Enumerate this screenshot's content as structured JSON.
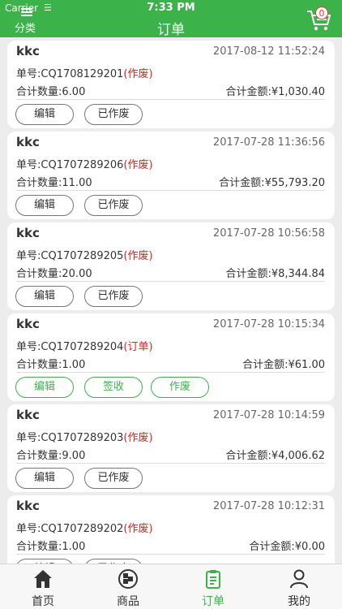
{
  "status_bar": {
    "carrier": "Carrier",
    "time": "7:33 PM"
  },
  "nav": {
    "category_label": "分类",
    "title": "订单",
    "cart_badge": "0"
  },
  "orders": [
    {
      "customer": "kkc",
      "date": "2017-08-12 11:52:24",
      "order_prefix": "单号:",
      "order_no": "CQ1708129201",
      "status": "(作废)",
      "qty_label": "合计数量:",
      "qty": "6.00",
      "amount_label": "合计金额:",
      "amount": "¥1,030.40",
      "buttons": [
        "编辑",
        "已作废"
      ]
    },
    {
      "customer": "kkc",
      "date": "2017-07-28 11:36:56",
      "order_prefix": "单号:",
      "order_no": "CQ1707289206",
      "status": "(作废)",
      "qty_label": "合计数量:",
      "qty": "11.00",
      "amount_label": "合计金额:",
      "amount": "¥55,793.20",
      "buttons": [
        "编辑",
        "已作废"
      ]
    },
    {
      "customer": "kkc",
      "date": "2017-07-28 10:56:58",
      "order_prefix": "单号:",
      "order_no": "CQ1707289205",
      "status": "(作废)",
      "qty_label": "合计数量:",
      "qty": "20.00",
      "amount_label": "合计金额:",
      "amount": "¥8,344.84",
      "buttons": [
        "编辑",
        "已作废"
      ]
    },
    {
      "customer": "kkc",
      "date": "2017-07-28 10:15:34",
      "order_prefix": "单号:",
      "order_no": "CQ1707289204",
      "status": "(订单)",
      "qty_label": "合计数量:",
      "qty": "1.00",
      "amount_label": "合计金额:",
      "amount": "¥61.00",
      "buttons": [
        "编辑",
        "签收",
        "作废"
      ]
    },
    {
      "customer": "kkc",
      "date": "2017-07-28 10:14:59",
      "order_prefix": "单号:",
      "order_no": "CQ1707289203",
      "status": "(作废)",
      "qty_label": "合计数量:",
      "qty": "9.00",
      "amount_label": "合计金额:",
      "amount": "¥4,006.62",
      "buttons": [
        "编辑",
        "已作废"
      ]
    },
    {
      "customer": "kkc",
      "date": "2017-07-28 10:12:31",
      "order_prefix": "单号:",
      "order_no": "CQ1707289202",
      "status": "(作废)",
      "qty_label": "合计数量:",
      "qty": "1.00",
      "amount_label": "合计金额:",
      "amount": "¥0.00",
      "buttons": [
        "编辑",
        "已作废"
      ]
    }
  ],
  "tabbar": {
    "items": [
      {
        "label": "首页",
        "icon": "home-icon"
      },
      {
        "label": "商品",
        "icon": "products-icon"
      },
      {
        "label": "订单",
        "icon": "orders-icon",
        "active": true
      },
      {
        "label": "我的",
        "icon": "profile-icon"
      }
    ]
  },
  "colors": {
    "brand": "#3cb34a",
    "status_red": "#d22",
    "background": "#ececec"
  }
}
